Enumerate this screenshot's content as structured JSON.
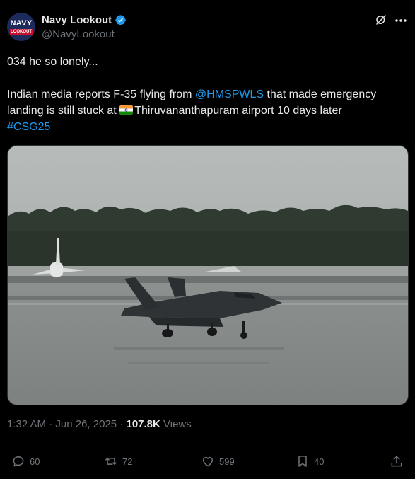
{
  "author": {
    "display_name": "Navy Lookout",
    "handle": "@NavyLookout",
    "avatar_text_top": "NAVY",
    "avatar_text_bottom": "LOOKOUT",
    "verified": true
  },
  "tweet": {
    "line1": "034 he so lonely...",
    "line2_pre": "Indian media reports F-35 flying from ",
    "mention": "@HMSPWLS",
    "line2_post": " that made emergency landing is still stuck at ",
    "line2_end": "Thiruvananthapuram airport 10 days later",
    "hashtag": "#CSG25",
    "flag_icon": "india-flag-icon"
  },
  "meta": {
    "time": "1:32 AM",
    "separator": " · ",
    "date": "Jun 26, 2025",
    "views_count": "107.8K",
    "views_label": " Views"
  },
  "actions": {
    "replies": "60",
    "reposts": "72",
    "likes": "599",
    "bookmarks": "40"
  },
  "colors": {
    "background": "#000000",
    "text": "#e7e9ea",
    "secondary": "#71767b",
    "link": "#1d9bf0",
    "border": "#2f3336"
  }
}
